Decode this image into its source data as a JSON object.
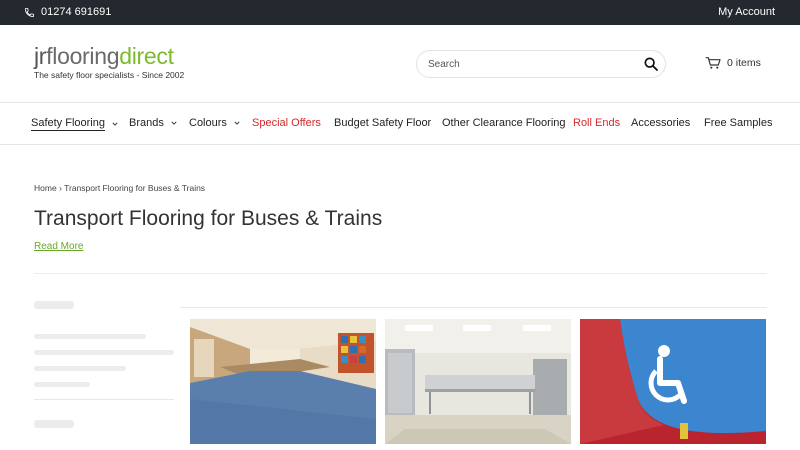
{
  "topbar": {
    "phone": "01274 691691",
    "account": "My Account",
    "background": "#23292e"
  },
  "header": {
    "logo": {
      "jr": "jr",
      "flooring": "flooring",
      "direct": "direct",
      "tagline": "The safety floor specialists - Since 2002",
      "accent": "#7cbb2d"
    },
    "search": {
      "placeholder": "Search"
    },
    "cart": {
      "label": "0 items",
      "icon": "cart-icon"
    }
  },
  "nav": {
    "items": [
      {
        "label": "Safety Flooring",
        "dropdown": true
      },
      {
        "label": "Brands",
        "dropdown": true
      },
      {
        "label": "Colours",
        "dropdown": true
      },
      {
        "label": "Special Offers",
        "color": "#d4282c"
      },
      {
        "label": "Budget Safety Floor"
      },
      {
        "label": "Other Clearance Flooring"
      },
      {
        "label": "Roll Ends",
        "color": "#d4282c"
      },
      {
        "label": "Accessories"
      },
      {
        "label": "Free Samples"
      }
    ]
  },
  "breadcrumb": {
    "home": "Home",
    "separator": "›",
    "current": "Transport Flooring for Buses & Trains"
  },
  "page": {
    "title": "Transport Flooring for Buses & Trains",
    "read_more": "Read More"
  },
  "products": [
    {
      "image": "corridor-blue-floor-photo"
    },
    {
      "image": "kitchen-grey-floor-photo"
    },
    {
      "image": "wheelchair-sign-blue-red-floor-photo"
    }
  ]
}
